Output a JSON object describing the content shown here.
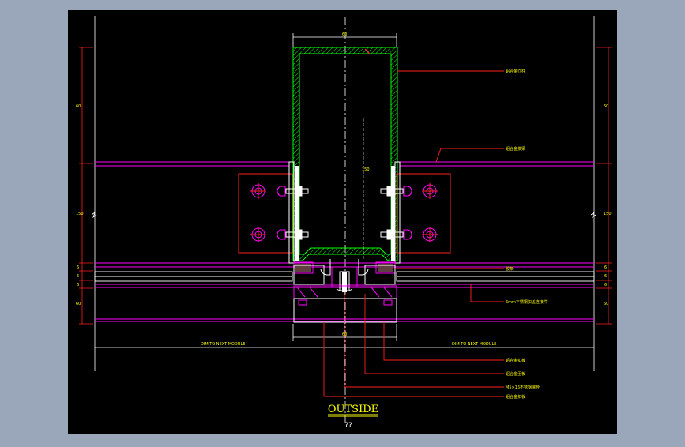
{
  "canvas": {
    "background": "#000000",
    "surround": "#9aa7bb"
  },
  "colors": {
    "profile": "#00ff00",
    "dims": "#ff2020",
    "leader": "#ff2020",
    "magenta": "#ff00ff",
    "white": "#ffffff",
    "label": "#ffff00",
    "gasket": "#c080a0"
  },
  "labels": {
    "right": [
      "铝合金立柱",
      "铝合金横梁",
      "胶条",
      "6mm不锈钢扣盖连接件"
    ],
    "bottom": [
      "铝合金扣板",
      "铝合金压板",
      "M5×16不锈钢螺栓",
      "铝合金扣板"
    ],
    "dim_left": "DIM TO NEXT MODULE",
    "dim_right": "DIM TO NEXT MODULE",
    "dim_top": "60",
    "dim_bottom": "60",
    "dim_center_height": "150",
    "left_dims": [
      "60",
      "150",
      "6",
      "6",
      "6",
      "60"
    ],
    "right_dims": [
      "60",
      "150",
      "6",
      "6",
      "6",
      "60"
    ]
  },
  "footer": {
    "title": "OUTSIDE",
    "subtitle": "??"
  }
}
